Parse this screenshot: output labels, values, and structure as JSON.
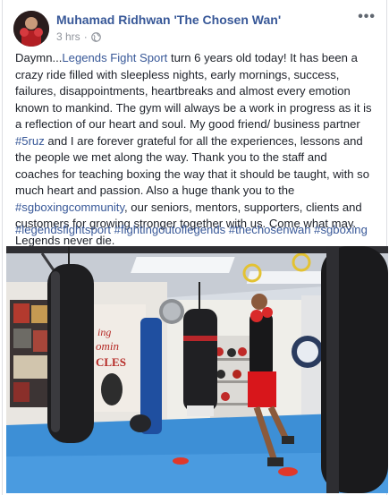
{
  "post": {
    "author": "Muhamad Ridhwan 'The Chosen Wan'",
    "time": "3 hrs",
    "time_separator": "·",
    "privacy_icon": "globe-icon",
    "more_icon": "more-options-icon",
    "more_label": "•••",
    "text_parts": [
      "Daymn...",
      "Legends Fight Sport",
      " turn 6 years old today! It has been a crazy ride filled with sleepless nights, early mornings, success, failures, disappointments, heartbreaks and almost every emotion known to mankind. The gym will always be a work in progress as it is a reflection of our heart and soul. My good friend/ business partner ",
      "#5ruz",
      " and I are forever grateful for all the experiences, lessons and the people we met along the way. Thank you to the staff and coaches for teaching boxing the way that it should be taught, with so much heart and passion. Also a huge thank you to the ",
      "#sgboxingcommunity",
      ", our seniors, mentors, supporters, clients and customers for growing stronger together with us. Come what may. Legends never die."
    ],
    "hashtags": [
      "#legendsfightsport",
      "#fightingoutoflegends",
      "#thechosenwan",
      "#sgboxing"
    ],
    "photo": {
      "description_name": "boxing-gym-photo",
      "wall_text": [
        "ing",
        "omin",
        "CLES"
      ]
    }
  },
  "colors": {
    "link": "#385898",
    "text": "#1d2129",
    "meta": "#90949c",
    "trunks": "#d8161b",
    "floor": "#3d8fd6"
  }
}
